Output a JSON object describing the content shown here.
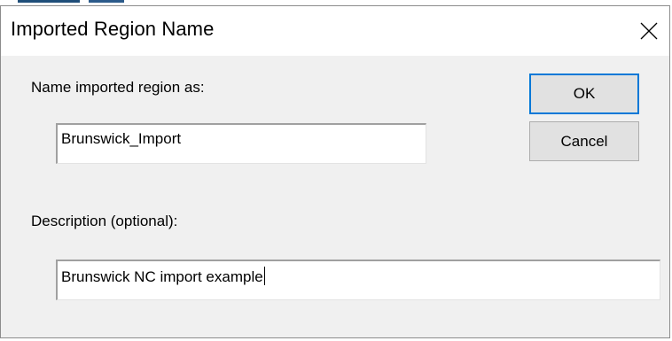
{
  "dialog": {
    "title": "Imported Region Name",
    "close_icon": "close-icon"
  },
  "form": {
    "name_label": "Name imported region as:",
    "name_value": "Brunswick_Import",
    "description_label": "Description (optional):",
    "description_value": "Brunswick NC import example"
  },
  "buttons": {
    "ok_label": "OK",
    "cancel_label": "Cancel"
  },
  "colors": {
    "focus_border": "#0078d7",
    "dialog_bg": "#f0f0f0",
    "button_bg": "#e1e1e1"
  }
}
